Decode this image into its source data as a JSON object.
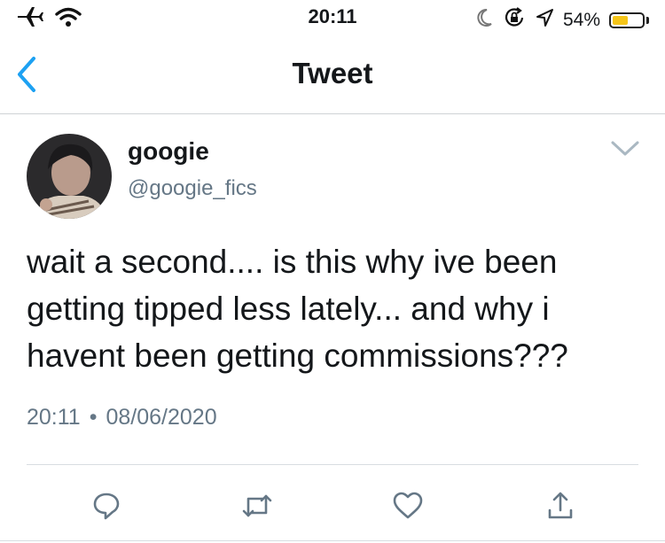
{
  "status_bar": {
    "time": "20:11",
    "battery_percent": "54%",
    "battery_level": 0.54,
    "battery_color": "#f5c518",
    "icons": [
      "airplane-icon",
      "wifi-icon",
      "moon-icon",
      "rotation-lock-icon",
      "location-icon",
      "battery-icon"
    ]
  },
  "nav": {
    "title": "Tweet",
    "back_icon": "chevron-left-icon",
    "accent_color": "#1da1f2"
  },
  "tweet": {
    "display_name": "googie",
    "handle": "@googie_fics",
    "text": "wait a second.... is this why ive been getting tipped less lately... and why i havent been getting commissions???",
    "time": "20:11",
    "separator": "•",
    "date": "08/06/2020",
    "menu_icon": "chevron-down-icon",
    "actions": [
      "reply-icon",
      "retweet-icon",
      "like-icon",
      "share-icon"
    ],
    "action_color": "#657786"
  }
}
